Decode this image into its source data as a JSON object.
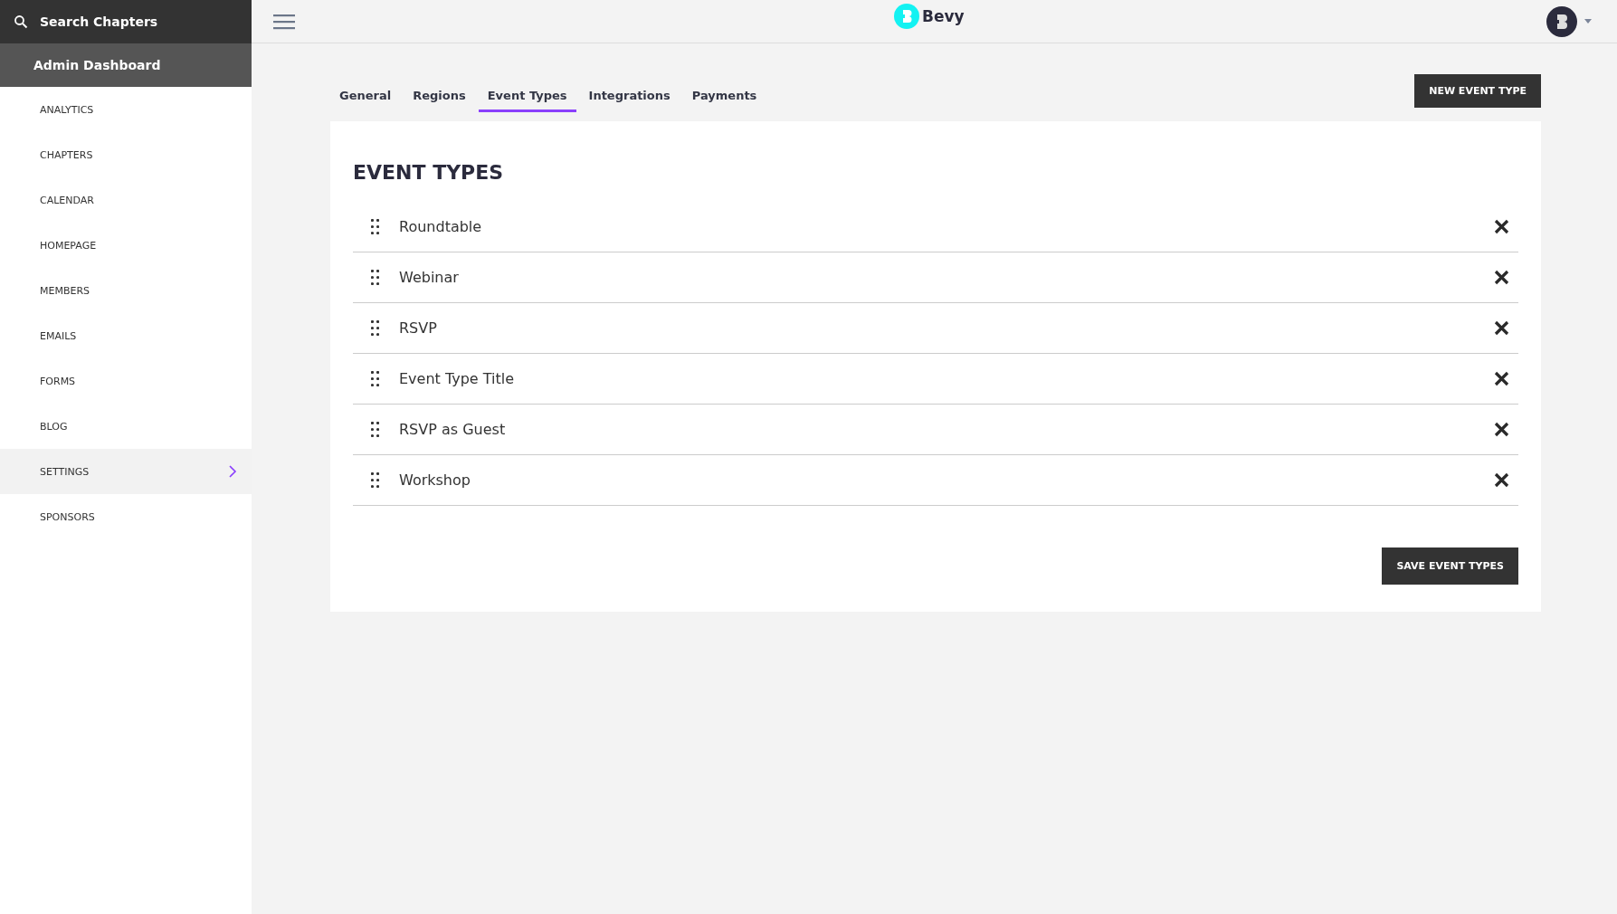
{
  "sidebar": {
    "search": {
      "placeholder": "Search Chapters"
    },
    "heading": "Admin Dashboard",
    "items": [
      {
        "label": "ANALYTICS",
        "selected": false
      },
      {
        "label": "CHAPTERS",
        "selected": false
      },
      {
        "label": "CALENDAR",
        "selected": false
      },
      {
        "label": "HOMEPAGE",
        "selected": false
      },
      {
        "label": "MEMBERS",
        "selected": false
      },
      {
        "label": "EMAILS",
        "selected": false
      },
      {
        "label": "FORMS",
        "selected": false
      },
      {
        "label": "BLOG",
        "selected": false
      },
      {
        "label": "SETTINGS",
        "selected": true
      },
      {
        "label": "SPONSORS",
        "selected": false
      }
    ]
  },
  "header": {
    "logo": "Bevy"
  },
  "tabs": [
    {
      "label": "General",
      "selected": false
    },
    {
      "label": "Regions",
      "selected": false
    },
    {
      "label": "Event Types",
      "selected": true
    },
    {
      "label": "Integrations",
      "selected": false
    },
    {
      "label": "Payments",
      "selected": false
    }
  ],
  "new_button": "NEW EVENT TYPE",
  "card": {
    "title": "EVENT TYPES",
    "event_types": [
      "Roundtable",
      "Webinar",
      "RSVP",
      "Event Type Title",
      "RSVP as Guest",
      "Workshop"
    ],
    "save_button": "SAVE EVENT TYPES"
  }
}
